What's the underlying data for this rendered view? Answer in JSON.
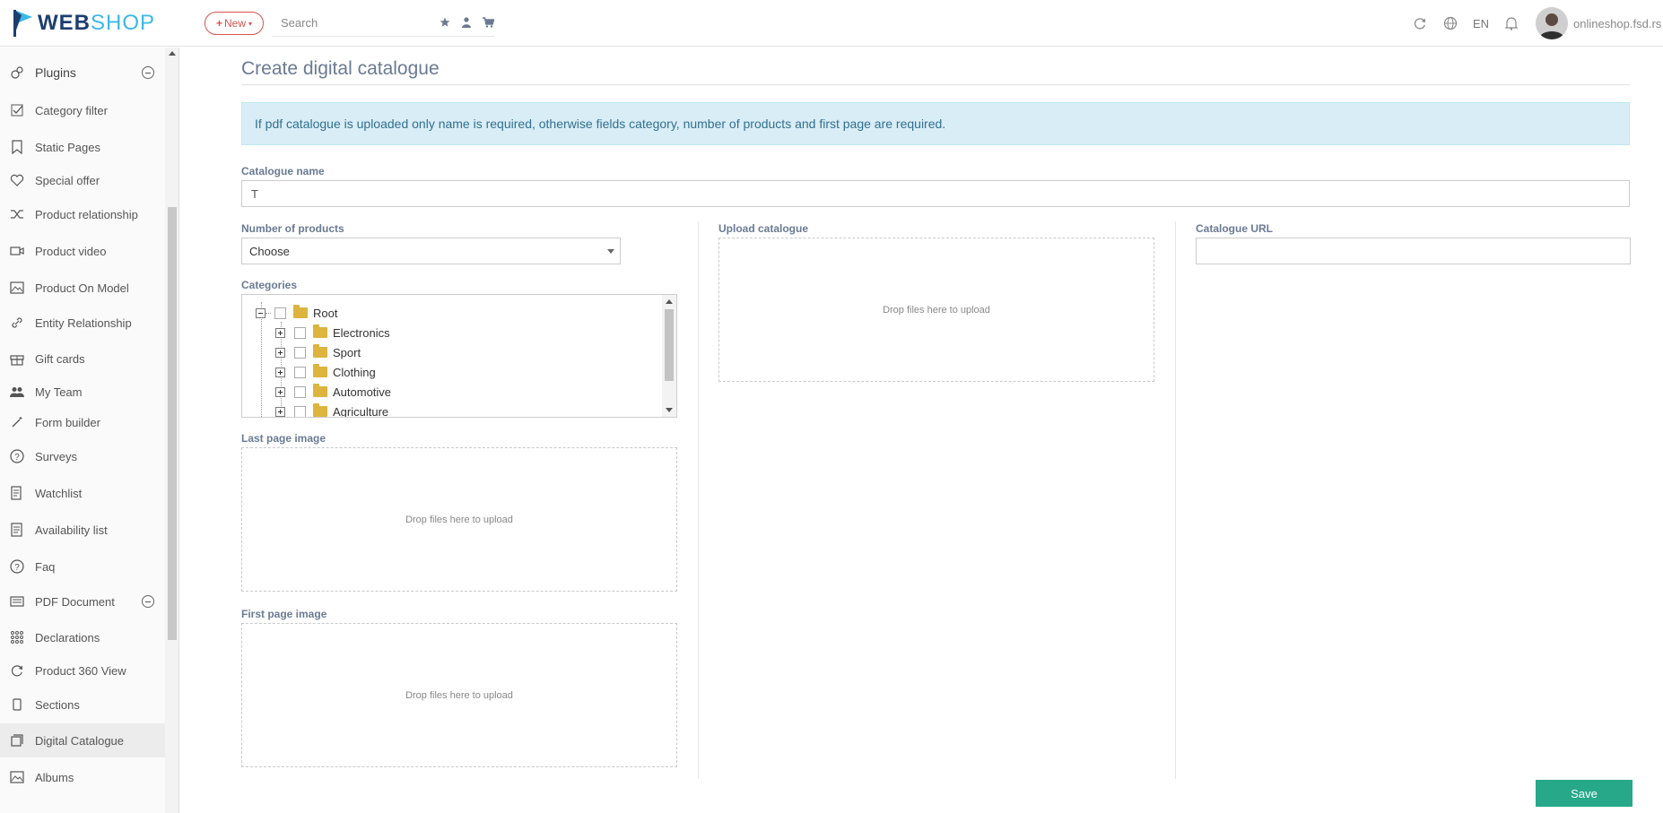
{
  "header": {
    "logo_web": "WEB",
    "logo_shop": "SHOP",
    "new_label": "New",
    "search_placeholder": "Search",
    "lang": "EN",
    "site": "onlineshop.fsd.rs",
    "icons": [
      "star-icon",
      "user-icon",
      "cart-icon",
      "refresh-icon",
      "globe-icon",
      "bell-icon"
    ]
  },
  "sidebar": {
    "items": [
      {
        "label": "Plugins",
        "icon": "plugins-icon"
      },
      {
        "label": "Category filter",
        "icon": "checkbox-icon"
      },
      {
        "label": "Static Pages",
        "icon": "bookmark-icon"
      },
      {
        "label": "Special offer",
        "icon": "heart-icon"
      },
      {
        "label": "Product relationship",
        "icon": "shuffle-icon"
      },
      {
        "label": "Product video",
        "icon": "video-icon"
      },
      {
        "label": "Product On Model",
        "icon": "image-icon"
      },
      {
        "label": "Entity Relationship",
        "icon": "link-icon"
      },
      {
        "label": "Gift cards",
        "icon": "gift-icon"
      },
      {
        "label": "My Team",
        "icon": "team-icon"
      },
      {
        "label": "Form builder",
        "icon": "wand-icon"
      },
      {
        "label": "Surveys",
        "icon": "question-icon"
      },
      {
        "label": "Watchlist",
        "icon": "watchlist-icon"
      },
      {
        "label": "Availability list",
        "icon": "list-icon"
      },
      {
        "label": "Faq",
        "icon": "question-icon"
      },
      {
        "label": "PDF Document",
        "icon": "pdf-icon"
      },
      {
        "label": "Declarations",
        "icon": "grid-icon"
      },
      {
        "label": "Product 360 View",
        "icon": "rotate-icon"
      },
      {
        "label": "Sections",
        "icon": "mobile-icon"
      },
      {
        "label": "Digital Catalogue",
        "icon": "catalogue-icon"
      },
      {
        "label": "Albums",
        "icon": "album-icon"
      }
    ]
  },
  "main": {
    "title": "Create digital catalogue",
    "alert": "If pdf catalogue is uploaded only name is required, otherwise fields category, number of products and first page are required.",
    "catalogue_name_label": "Catalogue name",
    "catalogue_name_value": "T",
    "number_of_products_label": "Number of products",
    "number_of_products_value": "Choose",
    "categories_label": "Categories",
    "categories": [
      "Root",
      "Electronics",
      "Sport",
      "Clothing",
      "Automotive",
      "Agriculture"
    ],
    "last_page_label": "Last page image",
    "first_page_label": "First page image",
    "upload_label": "Upload catalogue",
    "url_label": "Catalogue URL",
    "url_value": "",
    "drop_text": "Drop files here to upload",
    "save_label": "Save"
  },
  "colors": {
    "brand_dark": "#1d3f70",
    "brand_light": "#3cb8e6",
    "new_red": "#d9534f",
    "save_green": "#26a889",
    "alert_bg": "#d9edf7",
    "title": "#6a7a93"
  }
}
